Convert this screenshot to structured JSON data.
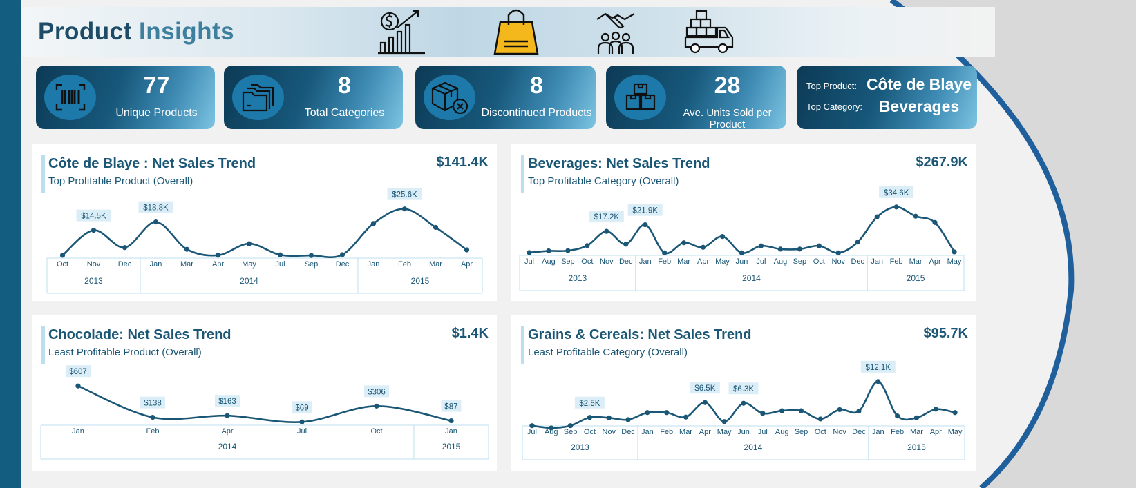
{
  "header": {
    "title_part1": "Product",
    "title_part2": "Insights"
  },
  "icons": [
    "revenue-growth-icon",
    "shopping-bag-icon",
    "handshake-team-icon",
    "delivery-truck-icon"
  ],
  "colors": {
    "primary": "#135d80",
    "line": "#1a5675",
    "label_bg": "#dbeef7",
    "bag": "#f4b81c"
  },
  "kpis": [
    {
      "value": "77",
      "label": "Unique Products",
      "icon": "barcode-icon"
    },
    {
      "value": "8",
      "label": "Total Categories",
      "icon": "folders-icon"
    },
    {
      "value": "8",
      "label": "Discontinued Products",
      "icon": "box-cancel-icon"
    },
    {
      "value": "28",
      "label": "Ave. Units Sold per Product",
      "icon": "boxes-icon"
    }
  ],
  "top": {
    "product_label": "Top Product:",
    "product_value": "Côte de Blaye",
    "category_label": "Top Category:",
    "category_value": "Beverages"
  },
  "chart_data": [
    {
      "type": "line",
      "title": "Côte de Blaye : Net Sales Trend",
      "subtitle": "Top Profitable Product (Overall)",
      "total": "$141.4K",
      "x": [
        "Oct",
        "Nov",
        "Dec",
        "Jan",
        "Mar",
        "Apr",
        "May",
        "Jul",
        "Sep",
        "Dec",
        "Jan",
        "Feb",
        "Mar",
        "Apr"
      ],
      "year_groups": [
        {
          "year": "2013",
          "count": 3
        },
        {
          "year": "2014",
          "count": 7
        },
        {
          "year": "2015",
          "count": 4
        }
      ],
      "values": [
        1500,
        14500,
        5500,
        18800,
        4600,
        1500,
        7500,
        1700,
        1400,
        1800,
        18000,
        25600,
        16000,
        4300
      ],
      "point_labels": [
        null,
        "$14.5K",
        null,
        "$18.8K",
        null,
        null,
        null,
        null,
        null,
        null,
        null,
        "$25.6K",
        null,
        null
      ],
      "ylim": [
        0,
        28000
      ]
    },
    {
      "type": "line",
      "title": "Beverages: Net Sales Trend",
      "subtitle": "Top Profitable Category (Overall)",
      "total": "$267.9K",
      "x": [
        "Jul",
        "Aug",
        "Sep",
        "Oct",
        "Nov",
        "Dec",
        "Jan",
        "Feb",
        "Mar",
        "Apr",
        "May",
        "Jun",
        "Jul",
        "Aug",
        "Sep",
        "Oct",
        "Nov",
        "Dec",
        "Jan",
        "Feb",
        "Mar",
        "Apr",
        "May"
      ],
      "year_groups": [
        {
          "year": "2013",
          "count": 6
        },
        {
          "year": "2014",
          "count": 12
        },
        {
          "year": "2015",
          "count": 5
        }
      ],
      "values": [
        2000,
        3200,
        3400,
        7000,
        17200,
        8000,
        21900,
        1800,
        9000,
        5800,
        13500,
        1800,
        6800,
        4500,
        4500,
        6800,
        1800,
        9500,
        27500,
        34600,
        28000,
        23500,
        2500
      ],
      "point_labels": [
        null,
        null,
        null,
        null,
        "$17.2K",
        null,
        "$21.9K",
        null,
        null,
        null,
        null,
        null,
        null,
        null,
        null,
        null,
        null,
        null,
        null,
        "$34.6K",
        null,
        null,
        null
      ],
      "ylim": [
        0,
        38000
      ]
    },
    {
      "type": "line",
      "title": "Chocolade: Net Sales Trend",
      "subtitle": "Least Profitable Product (Overall)",
      "total": "$1.4K",
      "x": [
        "Jan",
        "Feb",
        "Apr",
        "Jul",
        "Oct",
        "Jan"
      ],
      "year_groups": [
        {
          "year": "2014",
          "count": 5
        },
        {
          "year": "2015",
          "count": 1
        }
      ],
      "values": [
        607,
        138,
        163,
        69,
        306,
        87
      ],
      "point_labels": [
        "$607",
        "$138",
        "$163",
        "$69",
        "$306",
        "$87"
      ],
      "ylim": [
        0,
        650
      ]
    },
    {
      "type": "line",
      "title": "Grains & Cereals: Net Sales Trend",
      "subtitle": "Least Profitable Category (Overall)",
      "total": "$95.7K",
      "x": [
        "Jul",
        "Aug",
        "Sep",
        "Oct",
        "Nov",
        "Dec",
        "Jan",
        "Feb",
        "Mar",
        "Apr",
        "May",
        "Jun",
        "Jul",
        "Aug",
        "Sep",
        "Oct",
        "Nov",
        "Dec",
        "Jan",
        "Feb",
        "Mar",
        "Apr",
        "May"
      ],
      "year_groups": [
        {
          "year": "2013",
          "count": 6
        },
        {
          "year": "2014",
          "count": 12
        },
        {
          "year": "2015",
          "count": 5
        }
      ],
      "values": [
        300,
        -300,
        300,
        2500,
        2400,
        1900,
        3800,
        3800,
        2600,
        6500,
        1400,
        6300,
        3600,
        4300,
        4300,
        2100,
        4600,
        4200,
        12100,
        2900,
        2400,
        4700,
        3800
      ],
      "point_labels": [
        null,
        null,
        null,
        "$2.5K",
        null,
        null,
        null,
        null,
        null,
        "$6.5K",
        null,
        "$6.3K",
        null,
        null,
        null,
        null,
        null,
        null,
        "$12.1K",
        null,
        null,
        null,
        null
      ],
      "ylim": [
        -500,
        13000
      ]
    }
  ]
}
